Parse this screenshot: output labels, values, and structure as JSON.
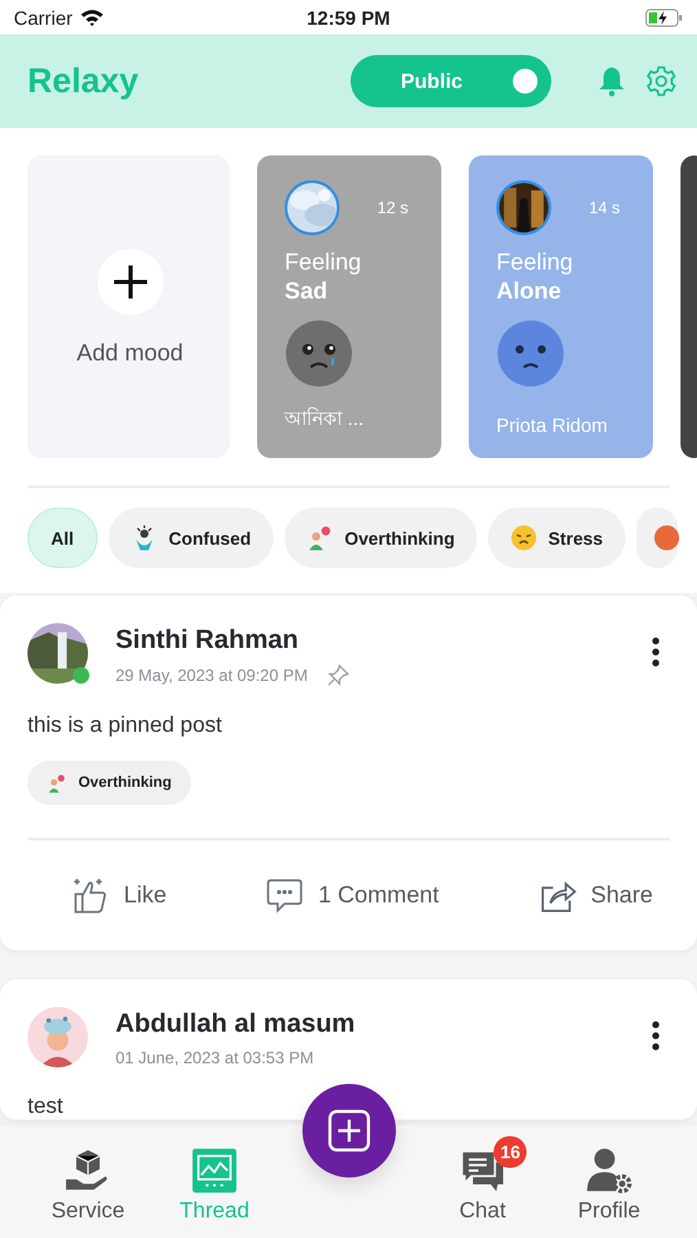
{
  "status_bar": {
    "carrier": "Carrier",
    "time": "12:59 PM"
  },
  "header": {
    "title": "Relaxy",
    "visibility_toggle": {
      "label": "Public",
      "on": true
    }
  },
  "moods": [
    {
      "kind": "add",
      "label": "Add mood"
    },
    {
      "kind": "mood",
      "time": "12 s",
      "feeling": "Feeling",
      "mood": "Sad",
      "name": "আনিকা ...",
      "color": "#a6a6a6",
      "face": {
        "kind": "sad"
      }
    },
    {
      "kind": "mood",
      "time": "14 s",
      "feeling": "Feeling",
      "mood": "Alone",
      "name": "Priota Ridom",
      "color": "#94b4ea",
      "face": {
        "kind": "alone"
      }
    },
    {
      "kind": "mood",
      "color": "#444444"
    }
  ],
  "filters": [
    {
      "kind": "all",
      "label": "All",
      "selected": true
    },
    {
      "kind": "confused",
      "label": "Confused",
      "selected": false
    },
    {
      "kind": "overthinking",
      "label": "Overthinking",
      "selected": false
    },
    {
      "kind": "stress",
      "label": "Stress",
      "selected": false
    },
    {
      "kind": "other",
      "selected": false
    }
  ],
  "posts": [
    {
      "author": "Sinthi Rahman",
      "time": "29 May, 2023 at 09:20 PM",
      "pinned": true,
      "online": true,
      "text": "this is a pinned post",
      "tags": [
        {
          "kind": "overthinking",
          "label": "Overthinking"
        }
      ],
      "actions": [
        {
          "kind": "like",
          "label": "Like"
        },
        {
          "kind": "comment",
          "label": "1 Comment"
        },
        {
          "kind": "share",
          "label": "Share"
        }
      ]
    },
    {
      "author": "Abdullah al masum",
      "time": "01 June, 2023 at 03:53 PM",
      "pinned": false,
      "online": false,
      "text": "test"
    }
  ],
  "bottom_nav": [
    {
      "kind": "service",
      "label": "Service",
      "selected": false
    },
    {
      "kind": "thread",
      "label": "Thread",
      "selected": true
    },
    {
      "kind": "chat",
      "label": "Chat",
      "selected": false,
      "badge": "16"
    },
    {
      "kind": "profile",
      "label": "Profile",
      "selected": false
    }
  ]
}
